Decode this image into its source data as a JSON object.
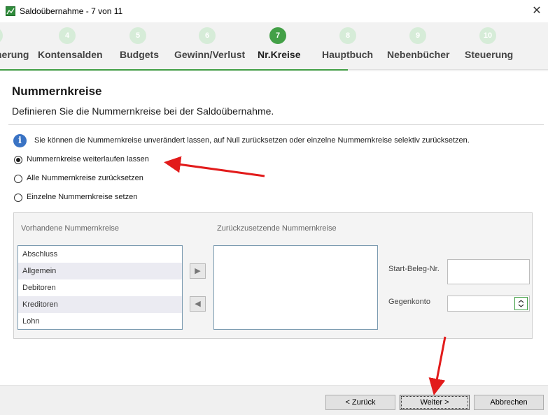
{
  "window": {
    "title": "Saldoübernahme - 7 von 11",
    "close_glyph": "✕"
  },
  "steps": [
    {
      "number": "",
      "label": "herung",
      "active": false
    },
    {
      "number": "4",
      "label": "Kontensalden",
      "active": false
    },
    {
      "number": "5",
      "label": "Budgets",
      "active": false
    },
    {
      "number": "6",
      "label": "Gewinn/Verlust",
      "active": false
    },
    {
      "number": "7",
      "label": "Nr.Kreise",
      "active": true
    },
    {
      "number": "8",
      "label": "Hauptbuch",
      "active": false
    },
    {
      "number": "9",
      "label": "Nebenbücher",
      "active": false
    },
    {
      "number": "10",
      "label": "Steuerung",
      "active": false
    }
  ],
  "page": {
    "title": "Nummernkreise",
    "subtitle": "Definieren Sie die Nummernkreise bei der Saldoübernahme."
  },
  "info": {
    "icon_letter": "i",
    "text": "Sie können die Nummernkreise unverändert lassen, auf Null zurücksetzen oder einzelne Nummernkreise selektiv zurücksetzen."
  },
  "options": [
    {
      "label": "Nummernkreise weiterlaufen lassen",
      "checked": true
    },
    {
      "label": "Alle Nummernkreise zurücksetzen",
      "checked": false
    },
    {
      "label": "Einzelne Nummernkreise setzen",
      "checked": false
    }
  ],
  "panel": {
    "available_label": "Vorhandene Nummernkreise",
    "reset_label": "Zurückzusetzende Nummernkreise",
    "available_items": [
      "Abschluss",
      "Allgemein",
      "Debitoren",
      "Kreditoren",
      "Lohn"
    ],
    "reset_items": [],
    "move_right_glyph": "▶",
    "move_left_glyph": "◀",
    "start_beleg_label": "Start-Beleg-Nr.",
    "start_beleg_value": "",
    "gegenkonto_label": "Gegenkonto",
    "gegenkonto_value": ""
  },
  "footer": {
    "back_label": "< Zurück",
    "next_label": "Weiter >",
    "cancel_label": "Abbrechen"
  },
  "colors": {
    "accent_green": "#43a047",
    "annotation_red": "#e21b1b",
    "info_blue": "#3a73c4"
  }
}
